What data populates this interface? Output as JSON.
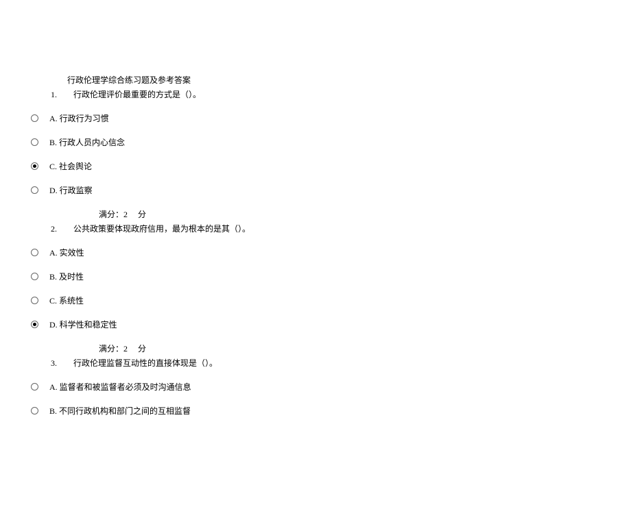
{
  "title": "行政伦理学综合练习题及参考答案",
  "q1": {
    "num": "1.",
    "text": "行政伦理评价最重要的方式是（）。",
    "options": {
      "a": "A. 行政行为习惯",
      "b": "B. 行政人员内心信念",
      "c": "C. 社会舆论",
      "d": "D. 行政监察"
    },
    "score": "满分：2  分"
  },
  "q2": {
    "num": "2.",
    "text": "公共政策要体现政府信用，最为根本的是其（）。",
    "options": {
      "a": "A. 实效性",
      "b": "B. 及时性",
      "c": "C. 系统性",
      "d": "D. 科学性和稳定性"
    },
    "score": "满分：2  分"
  },
  "q3": {
    "num": "3.",
    "text": "行政伦理监督互动性的直接体现是（）。",
    "options": {
      "a": "A. 监督者和被监督者必须及时沟通信息",
      "b": "B. 不同行政机构和部门之间的互相监督"
    }
  }
}
